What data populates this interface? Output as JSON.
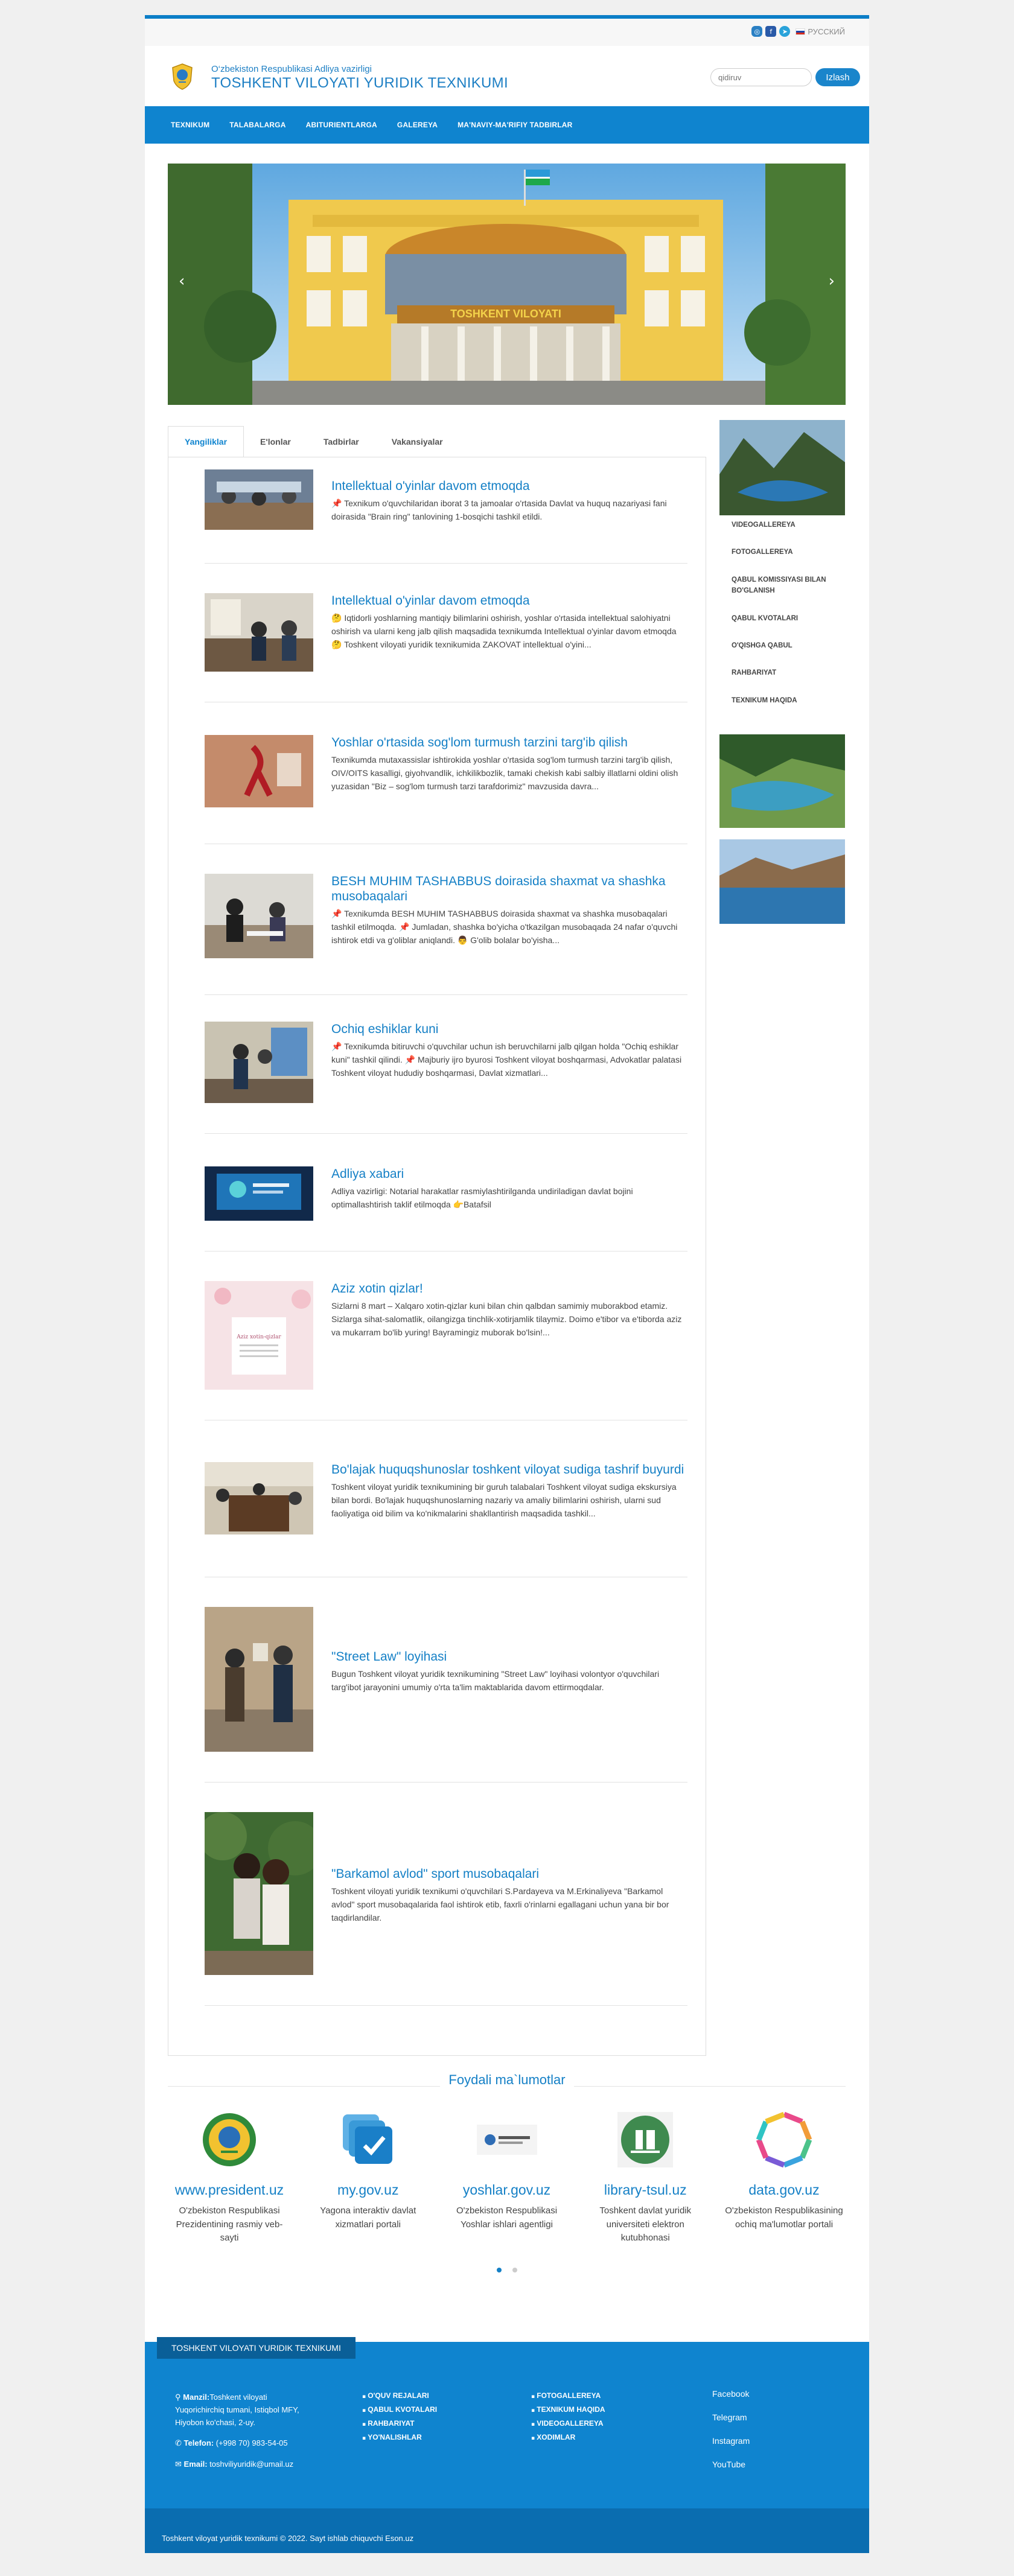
{
  "topbar": {
    "language": "РУССКИЙ"
  },
  "header": {
    "subtitle": "O‘zbekiston Respublikasi Adliya vazirligi",
    "title": "TOSHKENT VILOYATI YURIDIK TEXNIKUMI",
    "search_placeholder": "qidiruv",
    "search_button": "Izlash"
  },
  "nav": {
    "items": [
      "TEXNIKUM",
      "TALABALARGA",
      "ABITURIENTLARGA",
      "GALEREYA",
      "MA'NAVIY-MA'RIFIY TADBIRLAR"
    ]
  },
  "tabs": [
    "Yangiliklar",
    "E'lonlar",
    "Tadbirlar",
    "Vakansiyalar"
  ],
  "news": [
    {
      "title": "Intellektual o'yinlar davom etmoqda",
      "text": "📌 Texnikum o'quvchilaridan iborat 3 ta jamoalar o'rtasida Davlat va huquq nazariyasi fani doirasida \"Brain ring\" tanlovining 1-bosqichi tashkil etildi."
    },
    {
      "title": "Intellektual o'yinlar davom etmoqda",
      "text": "🤔 Iqtidorli yoshlarning mantiqiy bilimlarini oshirish, yoshlar o'rtasida intellektual salohiyatni oshirish va ularni keng jalb qilish maqsadida texnikumda Intellektual o'yinlar davom etmoqda 🤔 Toshkent viloyati yuridik texnikumida ZAKOVAT intellektual o'yini..."
    },
    {
      "title": "Yoshlar o'rtasida sog'lom turmush tarzini targ'ib qilish",
      "text": " Texnikumda mutaxassislar ishtirokida yoshlar o'rtasida sog'lom turmush tarzini targ'ib qilish, OIV/OITS kasalligi, giyohvandlik, ichkilikbozlik, tamaki chekish kabi salbiy illatlarni oldini olish yuzasidan \"Biz – sog'lom turmush tarzi tarafdorimiz\" mavzusida davra..."
    },
    {
      "title": "BESH MUHIM TASHABBUS doirasida shaxmat va shashka musobaqalari",
      "text": "📌 Texnikumda BESH MUHIM TASHABBUS doirasida shaxmat va shashka musobaqalari tashkil etilmoqda. 📌 Jumladan, shashka bo'yicha o'tkazilgan musobaqada 24 nafar o'quvchi ishtirok etdi va g'oliblar aniqlandi. 👨 G'olib bolalar bo'yisha..."
    },
    {
      "title": "Ochiq eshiklar kuni",
      "text": "📌 Texnikumda bitiruvchi o'quvchilar uchun ish beruvchilarni jalb qilgan holda \"Ochiq eshiklar kuni\" tashkil qilindi. 📌 Majburiy ijro byurosi Toshkent viloyat boshqarmasi, Advokatlar palatasi Toshkent viloyat hududiy boshqarmasi, Davlat xizmatlari..."
    },
    {
      "title": "Adliya xabari",
      "text": " Adliya vazirligi: Notarial harakatlar rasmiylashtirilganda undiriladigan davlat bojini optimallashtirish taklif etilmoqda 👉Batafsil"
    },
    {
      "title": "Aziz xotin qizlar!",
      "text": " Sizlarni 8 mart – Xalqaro xotin-qizlar kuni bilan chin qalbdan samimiy muborakbod etamiz. Sizlarga sihat-salomatlik, oilangizga tinchlik-xotirjamlik tilaymiz. Doimo e'tibor va e'tiborda aziz va mukarram bo'lib yuring! Bayramingiz muborak bo'lsin!..."
    },
    {
      "title": "Bo'lajak huquqshunoslar toshkent viloyat sudiga tashrif buyurdi",
      "text": " Toshkent viloyat yuridik texnikumining bir guruh talabalari Toshkent viloyat sudiga ekskursiya bilan bordi. Bo'lajak huquqshunoslarning nazariy va amaliy bilimlarini oshirish, ularni sud faoliyatiga oid bilim va ko'nikmalarini shakllantirish maqsadida tashkil..."
    },
    {
      "title": "\"Street Law\" loyihasi",
      "text": " Bugun Toshkent viloyat yuridik texnikumining \"Street Law\" loyihasi volontyor o'quvchilari targ'ibot jarayonini umumiy o'rta ta'lim maktablarida davom ettirmoqdalar."
    },
    {
      "title": "\"Barkamol avlod\" sport musobaqalari",
      "text": " Toshkent viloyati yuridik texnikumi o'quvchilari S.Pardayeva va M.Erkinaliyeva \"Barkamol avlod\" sport musobaqalarida faol ishtirok etib, faxrli o'rinlarni egallagani uchun yana bir bor taqdirlandilar."
    }
  ],
  "sidebar": {
    "menu": [
      "VIDEOGALLEREYA",
      "FOTOGALLEREYA",
      "QABUL KOMISSIYASI BILAN BO'GLANISH",
      "QABUL KVOTALARI",
      "O'QISHGA QABUL",
      "RAHBARIYAT",
      "TEXNIKUM HAQIDA"
    ]
  },
  "useful": {
    "title": "Foydali ma`lumotlar",
    "links": [
      {
        "name": "www.president.uz",
        "desc": "O'zbekiston Respublikasi Prezidentining rasmiy veb-sayti",
        "icon": "state-emblem-icon"
      },
      {
        "name": "my.gov.uz",
        "desc": "Yagona interaktiv davlat xizmatlari portali",
        "icon": "checkmark-icon"
      },
      {
        "name": "yoshlar.gov.uz",
        "desc": "O'zbekiston Respublikasi Yoshlar ishlari agentligi",
        "icon": "youth-agency-icon"
      },
      {
        "name": "library-tsul.uz",
        "desc": "Toshkent davlat yuridik universiteti elektron kutubhonasi",
        "icon": "library-icon"
      },
      {
        "name": "data.gov.uz",
        "desc": "O'zbekiston Respublikasining ochiq ma'lumotlar portali",
        "icon": "open-data-icon"
      }
    ]
  },
  "footer": {
    "badge": "TOSHKENT VILOYATI YURIDIK TEXNIKUMI",
    "address_label": "Manzil:",
    "address": "Toshkent viloyati Yuqorichirchiq tumani, Istiqbol MFY, Hiyobon ko'chasi, 2-uy.",
    "phone_label": "Telefon:",
    "phone": "(+998 70) 983-54-05",
    "email_label": "Email:",
    "email": "toshviliyuridik@umail.uz",
    "col2": [
      "O'QUV REJALARI",
      "QABUL KVOTALARI",
      "RAHBARIYAT",
      "YO'NALISHLAR"
    ],
    "col3": [
      "FOTOGALLEREYA",
      "TEXNIKUM HAQIDA",
      "VIDEOGALLEREYA",
      "XODIMLAR"
    ],
    "col4": [
      "Facebook",
      "Telegram",
      "Instagram",
      "YouTube"
    ],
    "copyright": "Toshkent viloyat yuridik texnikumi © 2022. Sayt ishlab chiquvchi Eson.uz"
  },
  "colors": {
    "brand": "#0f84cf",
    "link": "#1580c6",
    "footer": "#0f84cf"
  }
}
